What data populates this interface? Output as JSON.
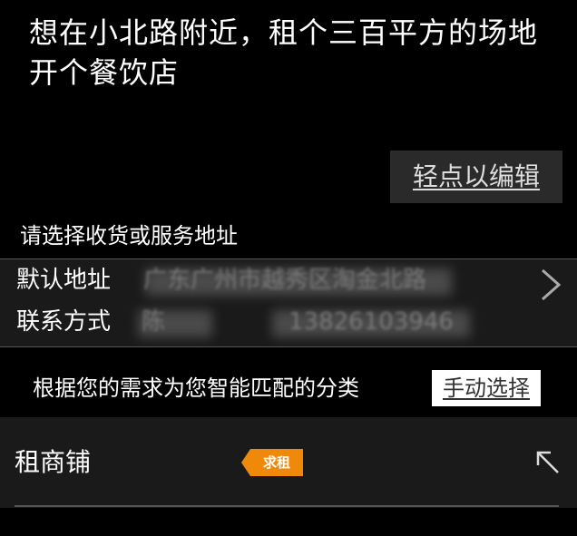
{
  "request": {
    "text": "想在小北路附近，租个三百平方的场地开个餐饮店"
  },
  "edit_button": {
    "label": "轻点以编辑"
  },
  "address": {
    "prompt": "请选择收货或服务地址",
    "default_label": "默认地址",
    "default_value": "广东广州市越秀区淘金北路",
    "contact_label": "联系方式",
    "contact_name": "陈",
    "contact_phone": "13826103946",
    "chevron_icon": "chevron-right-icon"
  },
  "matching": {
    "text": "根据您的需求为您智能匹配的分类",
    "manual_label": "手动选择"
  },
  "category": {
    "name": "租商铺",
    "tag": "求租",
    "tag_color": "#f0880a",
    "arrow_icon": "arrow-up-left-icon"
  }
}
